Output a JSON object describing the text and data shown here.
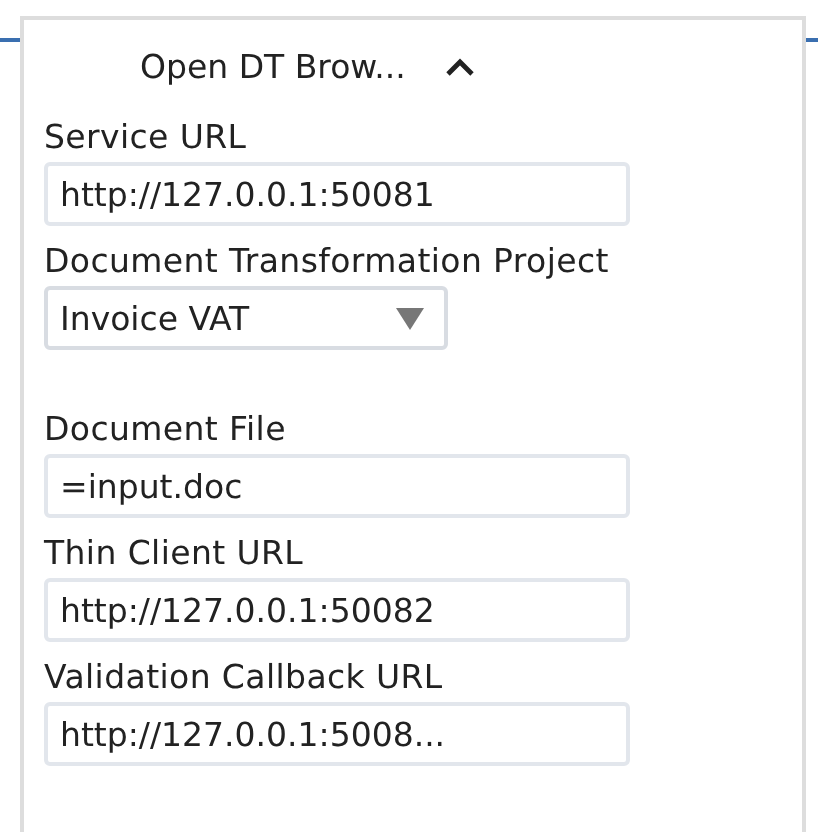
{
  "panel": {
    "title": "Open DT Brow...",
    "expanded": true
  },
  "fields": [
    {
      "label": "Service URL",
      "kind": "text",
      "value": "http://127.0.0.1:50081"
    },
    {
      "label": "Document Transformation Project",
      "kind": "select",
      "value": "Invoice VAT"
    },
    {
      "label": "Document File",
      "kind": "text",
      "value": "=input.doc"
    },
    {
      "label": "Thin Client URL",
      "kind": "text",
      "value": "http://127.0.0.1:50082"
    },
    {
      "label": "Validation Callback URL",
      "kind": "text",
      "value": "http://127.0.0.1:5008..."
    }
  ]
}
